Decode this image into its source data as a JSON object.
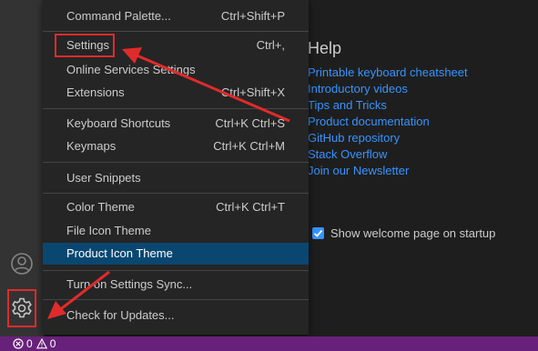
{
  "menu": {
    "items": [
      {
        "label": "Command Palette...",
        "keys": "Ctrl+Shift+P"
      },
      {
        "label": "Settings",
        "keys": "Ctrl+,"
      },
      {
        "label": "Online Services Settings",
        "keys": ""
      },
      {
        "label": "Extensions",
        "keys": "Ctrl+Shift+X"
      },
      {
        "label": "Keyboard Shortcuts",
        "keys": "Ctrl+K Ctrl+S"
      },
      {
        "label": "Keymaps",
        "keys": "Ctrl+K Ctrl+M"
      },
      {
        "label": "User Snippets",
        "keys": ""
      },
      {
        "label": "Color Theme",
        "keys": "Ctrl+K Ctrl+T"
      },
      {
        "label": "File Icon Theme",
        "keys": ""
      },
      {
        "label": "Product Icon Theme",
        "keys": ""
      },
      {
        "label": "Turn on Settings Sync...",
        "keys": ""
      },
      {
        "label": "Check for Updates...",
        "keys": ""
      }
    ],
    "selected": "Product Icon Theme"
  },
  "welcome": {
    "help_heading": "Help",
    "links": [
      "Printable keyboard cheatsheet",
      "Introductory videos",
      "Tips and Tricks",
      "Product documentation",
      "GitHub repository",
      "Stack Overflow",
      "Join our Newsletter"
    ],
    "show_on_startup_label": "Show welcome page on startup",
    "show_on_startup_checked": true
  },
  "activity_bar": {
    "icons": [
      "account-icon",
      "gear-icon"
    ]
  },
  "status_bar": {
    "errors": "0",
    "warnings": "0"
  },
  "colors": {
    "accent_link": "#3794ff",
    "menu_selection": "#094771",
    "status_bar": "#68217a",
    "annotation": "#e02b2b"
  }
}
